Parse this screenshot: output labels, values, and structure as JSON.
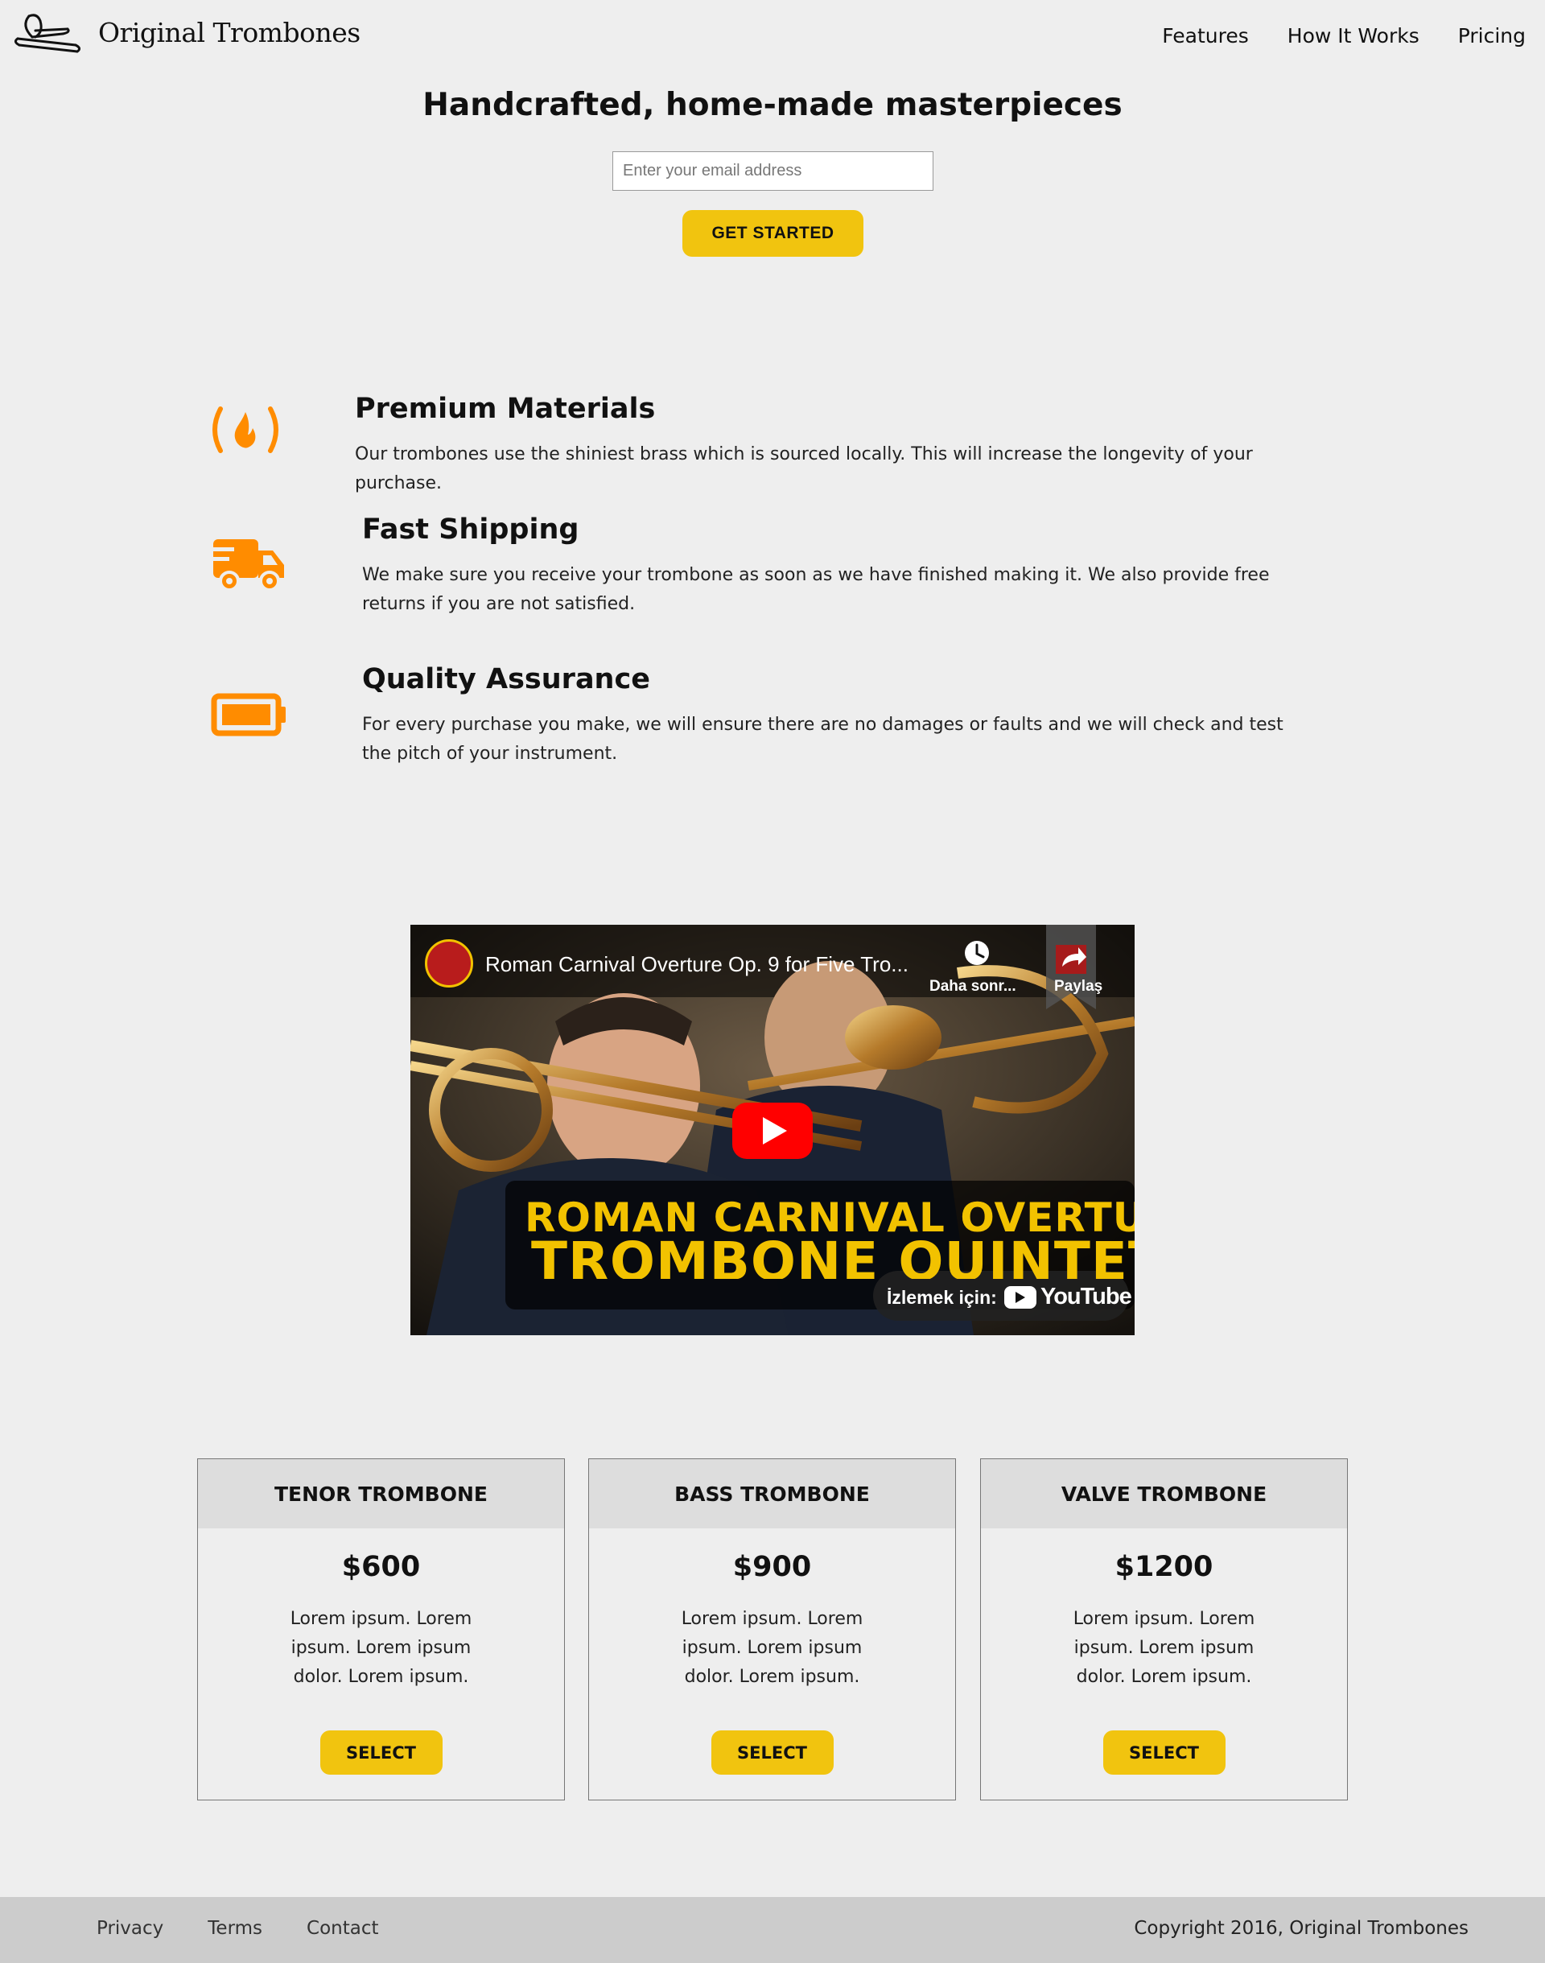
{
  "header": {
    "brand": "Original Trombones",
    "logo_icon": "trombone-icon",
    "nav": [
      "Features",
      "How It Works",
      "Pricing"
    ]
  },
  "hero": {
    "title": "Handcrafted, home-made masterpieces",
    "email_placeholder": "Enter your email address",
    "cta_label": "GET STARTED"
  },
  "features": [
    {
      "icon": "fire-icon",
      "title": "Premium Materials",
      "description": "Our trombones use the shiniest brass which is sourced locally. This will increase the longevity of your purchase."
    },
    {
      "icon": "truck-icon",
      "title": "Fast Shipping",
      "description": "We make sure you receive your trombone as soon as we have finished making it. We also provide free returns if you are not satisfied."
    },
    {
      "icon": "battery-icon",
      "title": "Quality Assurance",
      "description": "For every purchase you make, we will ensure there are no damages or faults and we will check and test the pitch of your instrument."
    }
  ],
  "video": {
    "title": "Roman Carnival Overture Op. 9 for Five Tro...",
    "watch_later": "Daha sonr...",
    "share": "Paylaş",
    "overlay_line1": "ROMAN CARNIVAL OVERTURE",
    "overlay_line2": "TROMBONE QUINTET",
    "watch_on": "İzlemek için:",
    "youtube": "YouTube"
  },
  "pricing": [
    {
      "name": "TENOR TROMBONE",
      "price": "$600",
      "description": "Lorem ipsum. Lorem ipsum. Lorem ipsum dolor. Lorem ipsum.",
      "button": "SELECT"
    },
    {
      "name": "BASS TROMBONE",
      "price": "$900",
      "description": "Lorem ipsum. Lorem ipsum. Lorem ipsum dolor. Lorem ipsum.",
      "button": "SELECT"
    },
    {
      "name": "VALVE TROMBONE",
      "price": "$1200",
      "description": "Lorem ipsum. Lorem ipsum. Lorem ipsum dolor. Lorem ipsum.",
      "button": "SELECT"
    }
  ],
  "footer": {
    "links": [
      "Privacy",
      "Terms",
      "Contact"
    ],
    "copyright": "Copyright 2016, Original Trombones"
  },
  "colors": {
    "accent": "#f1c40f",
    "icon_orange": "#ff8c00",
    "background": "#eeeeee",
    "footer_bg": "#cccccc"
  }
}
